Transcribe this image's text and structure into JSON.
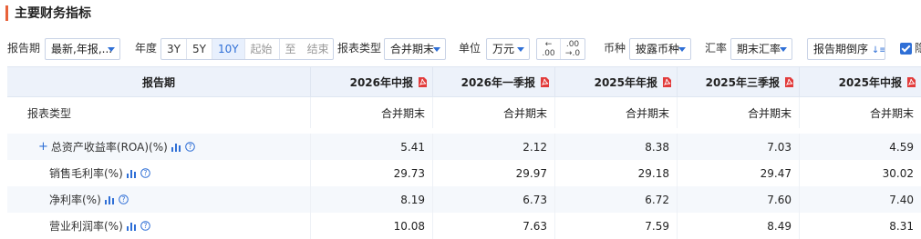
{
  "title": "主要财务指标",
  "toolbar": {
    "period_label": "报告期",
    "period_value": "最新,年报,...",
    "year_label": "年度",
    "year_options": [
      "3Y",
      "5Y",
      "10Y"
    ],
    "year_active": "10Y",
    "start_placeholder": "起始",
    "to_label": "至",
    "end_placeholder": "结束",
    "report_type_label": "报表类型",
    "report_type_value": "合并期末",
    "unit_label": "单位",
    "unit_value": "万元",
    "decimal_decrease": "←.0 .00",
    "decimal_increase": ".00 →.0",
    "currency_label": "币种",
    "currency_value": "披露币种",
    "rate_label": "汇率",
    "rate_value": "期末汇率",
    "sort_label": "报告期倒序",
    "checkbox_label": "隐"
  },
  "table": {
    "header_label": "报告期",
    "columns": [
      "2026年中报",
      "2026年一季报",
      "2025年年报",
      "2025年三季报",
      "2025年中报"
    ],
    "report_type_row": {
      "label": "报表类型",
      "values": [
        "合并期末",
        "合并期末",
        "合并期末",
        "合并期末",
        "合并期末"
      ]
    },
    "rows": [
      {
        "label": "总资产收益率(ROA)(%)",
        "expandable": true,
        "values": [
          "5.41",
          "2.12",
          "8.38",
          "7.03",
          "4.59"
        ]
      },
      {
        "label": "销售毛利率(%)",
        "expandable": false,
        "values": [
          "29.73",
          "29.97",
          "29.18",
          "29.47",
          "30.02"
        ]
      },
      {
        "label": "净利率(%)",
        "expandable": false,
        "values": [
          "8.19",
          "6.73",
          "6.72",
          "7.60",
          "7.40"
        ]
      },
      {
        "label": "营业利润率(%)",
        "expandable": false,
        "values": [
          "10.08",
          "7.63",
          "7.59",
          "8.49",
          "8.31"
        ]
      }
    ],
    "expand_symbol": "+"
  },
  "colors": {
    "accent": "#e8623a",
    "link": "#2f6fd6",
    "pdf": "#e23b3b",
    "header_bg": "#edf2fa"
  }
}
